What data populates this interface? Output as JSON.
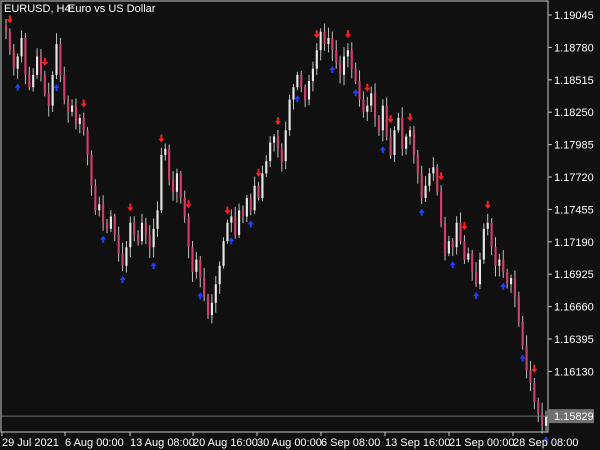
{
  "header": {
    "symbol": "EURUSD, H4:",
    "description": "Euro vs US Dollar"
  },
  "colors": {
    "background": "#101010",
    "frame": "#c8c8c8",
    "candle_bull": "#e8e8e8",
    "candle_bear": "#d0406a",
    "wick": "#c0c0c0",
    "arrow_down": "#ff2020",
    "arrow_up": "#2040ff",
    "price_line": "#707070",
    "price_tag_bg": "#707070",
    "price_tag_text": "#ffffff"
  },
  "chart_data": {
    "type": "candlestick",
    "symbol": "EURUSD",
    "timeframe": "H4",
    "y_ticks": [
      "1.19045",
      "1.18780",
      "1.18515",
      "1.18250",
      "1.17985",
      "1.17720",
      "1.17455",
      "1.17190",
      "1.16925",
      "1.16660",
      "1.16395",
      "1.16130"
    ],
    "ylim": [
      1.157,
      1.192
    ],
    "x_ticks": [
      "29 Jul 2021",
      "6 Aug 00:00",
      "13 Aug 08:00",
      "20 Aug 16:00",
      "30 Aug 00:00",
      "6 Sep 08:00",
      "13 Sep 16:00",
      "21 Sep 00:00",
      "28 Sep 08:00"
    ],
    "current_price": "1.15829",
    "current_price_value": 1.15829,
    "close_path": [
      1.1895,
      1.188,
      1.1865,
      1.1875,
      1.189,
      1.186,
      1.185,
      1.186,
      1.1875,
      1.186,
      1.1845,
      1.1835,
      1.186,
      1.1885,
      1.186,
      1.184,
      1.183,
      1.1835,
      1.182,
      1.1825,
      1.1815,
      1.1795,
      1.177,
      1.175,
      1.1755,
      1.174,
      1.1735,
      1.1745,
      1.173,
      1.1715,
      1.1705,
      1.172,
      1.174,
      1.173,
      1.1725,
      1.174,
      1.173,
      1.172,
      1.1735,
      1.175,
      1.1795,
      1.18,
      1.1775,
      1.1765,
      1.178,
      1.176,
      1.1745,
      1.172,
      1.17,
      1.171,
      1.1695,
      1.168,
      1.1665,
      1.1675,
      1.169,
      1.1705,
      1.1725,
      1.174,
      1.1745,
      1.173,
      1.175,
      1.1745,
      1.176,
      1.175,
      1.177,
      1.176,
      1.178,
      1.179,
      1.1805,
      1.181,
      1.18,
      1.179,
      1.1815,
      1.184,
      1.185,
      1.186,
      1.185,
      1.184,
      1.1855,
      1.1865,
      1.188,
      1.1895,
      1.1885,
      1.189,
      1.188,
      1.187,
      1.186,
      1.1875,
      1.188,
      1.1865,
      1.1855,
      1.184,
      1.183,
      1.1835,
      1.1845,
      1.1825,
      1.1815,
      1.1835,
      1.181,
      1.1795,
      1.1815,
      1.1825,
      1.18,
      1.181,
      1.1815,
      1.1795,
      1.178,
      1.176,
      1.177,
      1.178,
      1.1785,
      1.1765,
      1.174,
      1.1715,
      1.1725,
      1.172,
      1.174,
      1.1725,
      1.171,
      1.1715,
      1.17,
      1.169,
      1.171,
      1.1735,
      1.174,
      1.172,
      1.1705,
      1.171,
      1.17,
      1.169,
      1.1695,
      1.168,
      1.166,
      1.164,
      1.162,
      1.161,
      1.1595,
      1.1585,
      1.1575,
      1.1583
    ],
    "sell_arrows": [
      1,
      10,
      20,
      32,
      40,
      47,
      57,
      65,
      70,
      80,
      88,
      93,
      99,
      104,
      112,
      118,
      124,
      136
    ],
    "buy_arrows": [
      3,
      13,
      25,
      30,
      38,
      50,
      58,
      63,
      75,
      84,
      90,
      97,
      107,
      115,
      121,
      128,
      133,
      139
    ]
  }
}
